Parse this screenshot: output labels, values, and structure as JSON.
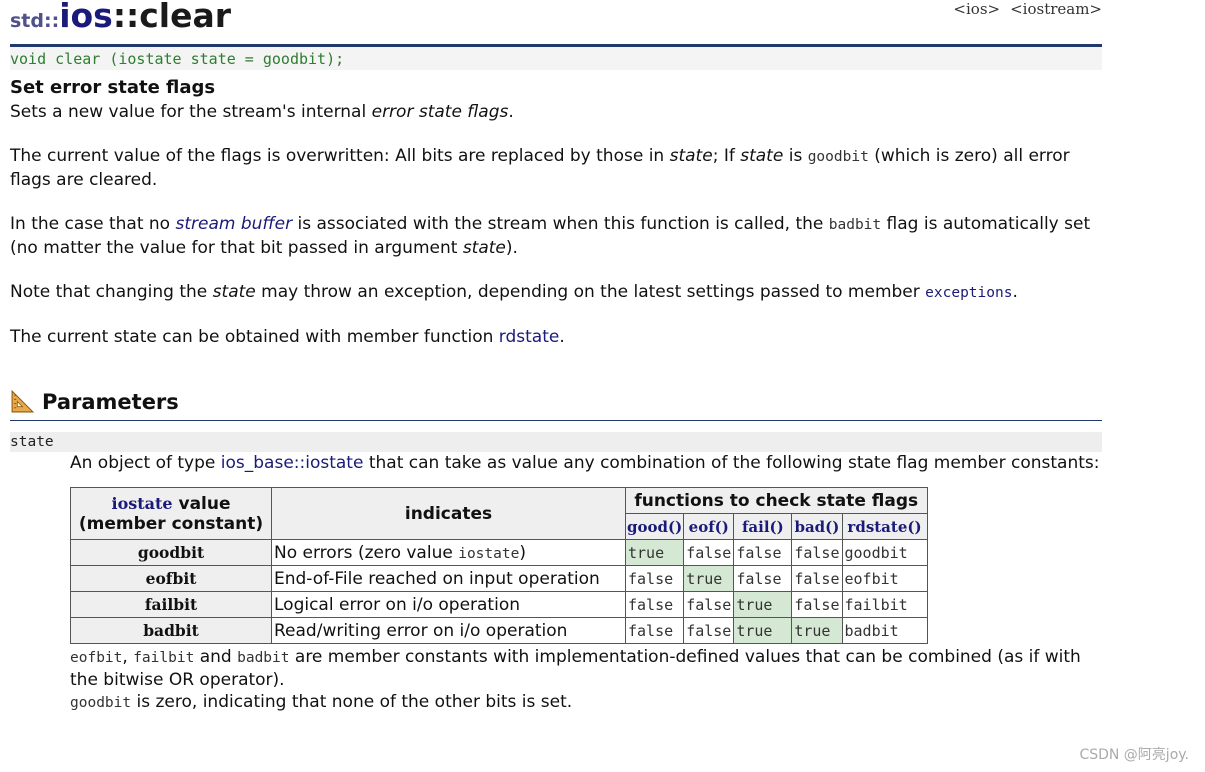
{
  "header": {
    "ns": "std::",
    "cls": "ios",
    "fn": "::clear",
    "links": [
      "<ios>",
      "<iostream>"
    ]
  },
  "prototype": "void clear (iostate state = goodbit);",
  "summary": "Set error state flags",
  "desc1": {
    "a": "Sets a new value for the stream's internal ",
    "b": "error state flags",
    "c": "."
  },
  "desc2": {
    "a": "The current value of the flags is overwritten: All bits are replaced by those in ",
    "b": "state",
    "c": "; If ",
    "d": "state",
    "e": " is ",
    "f": "goodbit",
    "g": " (which is zero) all error flags are cleared."
  },
  "desc3": {
    "a": "In the case that no ",
    "b": "stream buffer",
    "c": " is associated with the stream when this function is called, the ",
    "d": "badbit",
    "e": " flag is automatically set (no matter the value for that bit passed in argument ",
    "f": "state",
    "g": ")."
  },
  "desc4": {
    "a": "Note that changing the ",
    "b": "state",
    "c": " may throw an exception, depending on the latest settings passed to member ",
    "d": "exceptions",
    "e": "."
  },
  "desc5": {
    "a": "The current state can be obtained with member function ",
    "b": "rdstate",
    "c": "."
  },
  "params": {
    "title": "Parameters",
    "name": "state",
    "desc": {
      "a": "An object of type ",
      "b": "ios_base::iostate",
      "c": " that can take as value any combination of the following state flag member constants:"
    }
  },
  "table": {
    "h_value_code": "iostate",
    "h_value_a": " value",
    "h_value_b": "(member constant)",
    "h_indicates": "indicates",
    "h_functions": "functions to check state flags",
    "fn_headers": [
      "good()",
      "eof()",
      "fail()",
      "bad()",
      "rdstate()"
    ],
    "rows": [
      {
        "const": "goodbit",
        "ind": "No errors (zero value ",
        "ind_code": "iostate",
        "ind_end": ")",
        "vals": [
          "true",
          "false",
          "false",
          "false",
          "goodbit"
        ]
      },
      {
        "const": "eofbit",
        "ind": "End-of-File reached on input operation",
        "ind_code": "",
        "ind_end": "",
        "vals": [
          "false",
          "true",
          "false",
          "false",
          "eofbit"
        ]
      },
      {
        "const": "failbit",
        "ind": "Logical error on i/o operation",
        "ind_code": "",
        "ind_end": "",
        "vals": [
          "false",
          "false",
          "true",
          "false",
          "failbit"
        ]
      },
      {
        "const": "badbit",
        "ind": "Read/writing error on i/o operation",
        "ind_code": "",
        "ind_end": "",
        "vals": [
          "false",
          "false",
          "true",
          "true",
          "badbit"
        ]
      }
    ]
  },
  "note1": {
    "a": "eofbit",
    "b": ", ",
    "c": "failbit",
    "d": " and ",
    "e": "badbit",
    "f": " are member constants with implementation-defined values that can be combined (as if with the bitwise OR operator)."
  },
  "note2": {
    "a": "goodbit",
    "b": " is zero, indicating that none of the other bits is set."
  },
  "watermark": "CSDN @阿亮joy.",
  "colors": {
    "navy": "#1a1a7a",
    "rule": "#203a6e",
    "prototype": "#2e7d32",
    "highlight": "#d4e8d4"
  },
  "icons": {
    "section": "ruler-triangle-icon"
  }
}
